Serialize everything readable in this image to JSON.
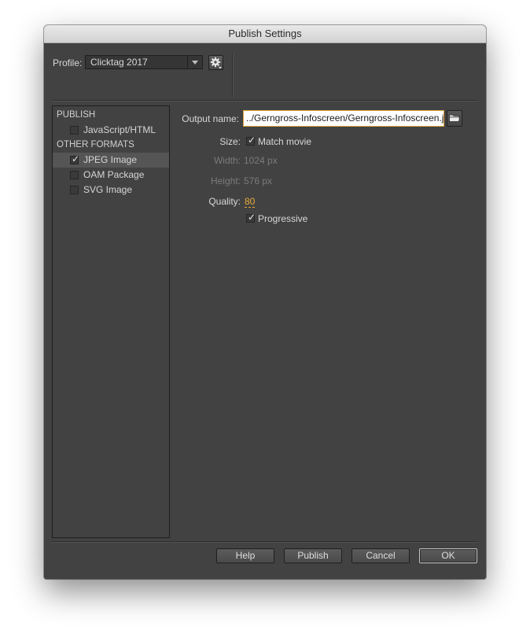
{
  "window": {
    "title": "Publish Settings"
  },
  "profile": {
    "label": "Profile:",
    "selected": "Clicktag 2017"
  },
  "sidebar": {
    "publish_heading": "PUBLISH",
    "publish_items": [
      {
        "label": "JavaScript/HTML",
        "checked": false
      }
    ],
    "other_heading": "OTHER FORMATS",
    "other_items": [
      {
        "label": "JPEG Image",
        "checked": true,
        "selected": true
      },
      {
        "label": "OAM Package",
        "checked": false
      },
      {
        "label": "SVG Image",
        "checked": false
      }
    ]
  },
  "form": {
    "output_label": "Output name:",
    "output_value": "../Gerngross-Infoscreen/Gerngross-Infoscreen.jpg",
    "size_label": "Size:",
    "match_movie_label": "Match movie",
    "match_movie_checked": true,
    "width_label": "Width:",
    "width_value": "1024 px",
    "height_label": "Height:",
    "height_value": "576 px",
    "quality_label": "Quality:",
    "quality_value": "80",
    "progressive_label": "Progressive",
    "progressive_checked": true
  },
  "buttons": {
    "help": "Help",
    "publish": "Publish",
    "cancel": "Cancel",
    "ok": "OK"
  },
  "colors": {
    "panel_bg": "#424242",
    "accent": "#e8a93a"
  }
}
